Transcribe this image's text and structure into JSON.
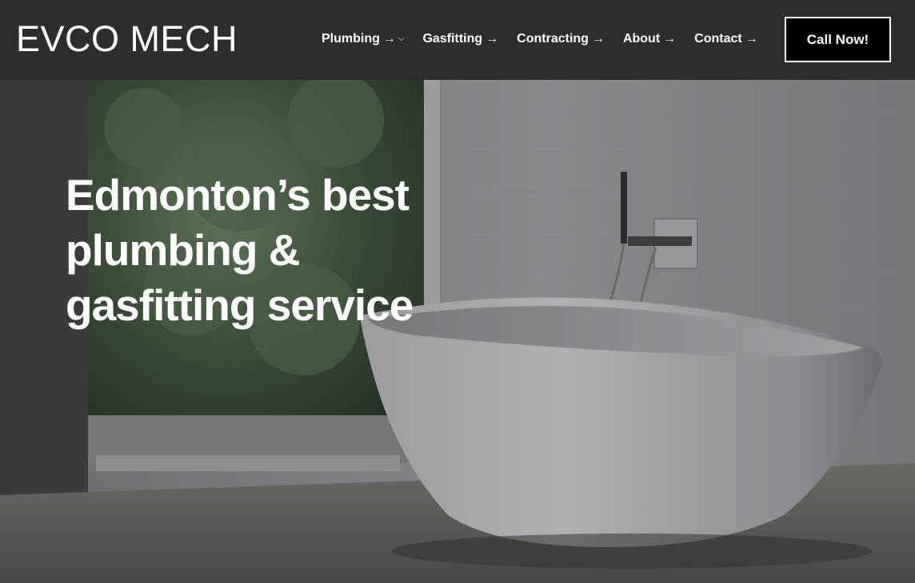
{
  "header": {
    "logo": "EVCO MECH",
    "nav": [
      {
        "label": "Plumbing",
        "arrow": "→",
        "has_dropdown": true
      },
      {
        "label": "Gasfitting",
        "arrow": "→",
        "has_dropdown": false
      },
      {
        "label": "Contracting",
        "arrow": "→",
        "has_dropdown": false
      },
      {
        "label": "About",
        "arrow": "→",
        "has_dropdown": false
      },
      {
        "label": "Contact",
        "arrow": "→",
        "has_dropdown": false
      }
    ],
    "dropdown_glyph": "⌵",
    "cta_label": "Call Now!"
  },
  "hero": {
    "headline": "Edmonton’s best plumbing & gasfitting service",
    "image": "bathtub-photo"
  },
  "colors": {
    "header_bg": "#2d2d2d",
    "cta_bg": "#000000",
    "text": "#ffffff"
  }
}
